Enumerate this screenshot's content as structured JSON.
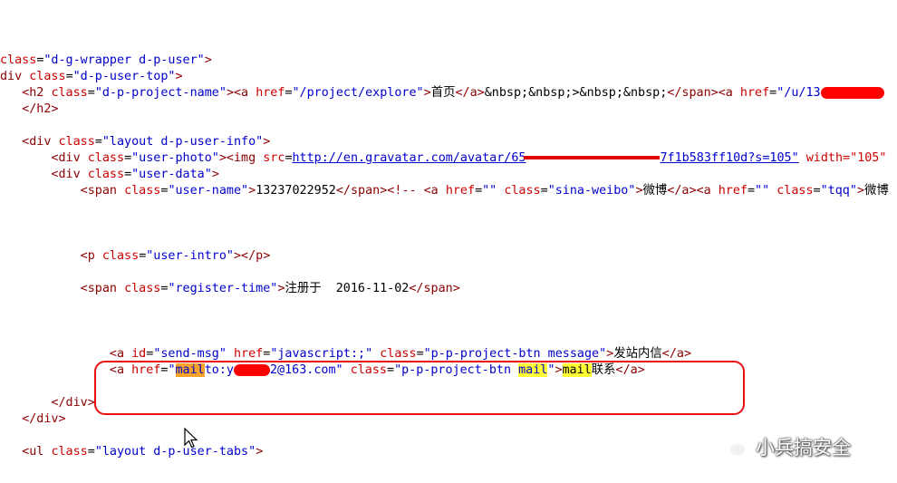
{
  "lines": [
    {
      "seg": [
        {
          "c": "attr",
          "t": "class"
        },
        {
          "c": "txt",
          "t": "="
        },
        {
          "c": "val",
          "t": "\"d-g-wrapper d-p-user\""
        },
        {
          "c": "tag",
          "t": ">"
        }
      ]
    },
    {
      "seg": [
        {
          "c": "tag",
          "t": "div "
        },
        {
          "c": "attr",
          "t": "class"
        },
        {
          "c": "txt",
          "t": "="
        },
        {
          "c": "val",
          "t": "\"d-p-user-top\""
        },
        {
          "c": "tag",
          "t": ">"
        }
      ]
    },
    {
      "seg": [
        {
          "c": "tag",
          "t": "   <h2 "
        },
        {
          "c": "attr",
          "t": "class"
        },
        {
          "c": "txt",
          "t": "="
        },
        {
          "c": "val",
          "t": "\"d-p-project-name\""
        },
        {
          "c": "tag",
          "t": "><a "
        },
        {
          "c": "attr",
          "t": "href"
        },
        {
          "c": "txt",
          "t": "="
        },
        {
          "c": "val",
          "t": "\"/project/explore\""
        },
        {
          "c": "tag",
          "t": ">"
        },
        {
          "c": "txt",
          "t": "首页"
        },
        {
          "c": "tag",
          "t": "</a>"
        },
        {
          "c": "txt",
          "t": "&nbsp;&nbsp;>&nbsp;&nbsp;"
        },
        {
          "c": "tag",
          "t": "</span><a "
        },
        {
          "c": "attr",
          "t": "href"
        },
        {
          "c": "txt",
          "t": "="
        },
        {
          "c": "val",
          "t": "\"/u/13"
        }
      ]
    },
    {
      "seg": [
        {
          "c": "tag",
          "t": "   </h2>"
        }
      ]
    },
    {
      "seg": []
    },
    {
      "seg": [
        {
          "c": "tag",
          "t": "   <div "
        },
        {
          "c": "attr",
          "t": "class"
        },
        {
          "c": "txt",
          "t": "="
        },
        {
          "c": "val",
          "t": "\"layout d-p-user-info\""
        },
        {
          "c": "tag",
          "t": ">"
        }
      ]
    },
    {
      "seg": [
        {
          "c": "tag",
          "t": "       <div "
        },
        {
          "c": "attr",
          "t": "class"
        },
        {
          "c": "txt",
          "t": "="
        },
        {
          "c": "val",
          "t": "\"user-photo\""
        },
        {
          "c": "tag",
          "t": "><img "
        },
        {
          "c": "attr",
          "t": "src"
        },
        {
          "c": "txt",
          "t": "="
        },
        {
          "c": "link",
          "t": "http://en.gravatar.com/avatar/65"
        }
      ]
    },
    {
      "seg": [
        {
          "c": "tag",
          "t": "       <div "
        },
        {
          "c": "attr",
          "t": "class"
        },
        {
          "c": "txt",
          "t": "="
        },
        {
          "c": "val",
          "t": "\"user-data\""
        },
        {
          "c": "tag",
          "t": ">"
        }
      ]
    },
    {
      "seg": [
        {
          "c": "tag",
          "t": "           <span "
        },
        {
          "c": "attr",
          "t": "class"
        },
        {
          "c": "txt",
          "t": "="
        },
        {
          "c": "val",
          "t": "\"user-name\""
        },
        {
          "c": "tag",
          "t": ">"
        },
        {
          "c": "txt",
          "t": "13237022952"
        },
        {
          "c": "tag",
          "t": "</span><!-- <a "
        },
        {
          "c": "attr",
          "t": "href"
        },
        {
          "c": "txt",
          "t": "="
        },
        {
          "c": "val",
          "t": "\"\""
        },
        {
          "c": "txt",
          "t": " "
        },
        {
          "c": "attr",
          "t": "class"
        },
        {
          "c": "txt",
          "t": "="
        },
        {
          "c": "val",
          "t": "\"sina-weibo\""
        },
        {
          "c": "tag",
          "t": ">"
        },
        {
          "c": "txt",
          "t": "微博"
        },
        {
          "c": "tag",
          "t": "</a><a "
        },
        {
          "c": "attr",
          "t": "href"
        },
        {
          "c": "txt",
          "t": "="
        },
        {
          "c": "val",
          "t": "\"\""
        },
        {
          "c": "txt",
          "t": " "
        },
        {
          "c": "attr",
          "t": "class"
        },
        {
          "c": "txt",
          "t": "="
        },
        {
          "c": "val",
          "t": "\"tqq\""
        },
        {
          "c": "tag",
          "t": ">"
        },
        {
          "c": "txt",
          "t": "微博"
        }
      ]
    },
    {
      "seg": []
    },
    {
      "seg": []
    },
    {
      "seg": []
    },
    {
      "seg": [
        {
          "c": "tag",
          "t": "           <p "
        },
        {
          "c": "attr",
          "t": "class"
        },
        {
          "c": "txt",
          "t": "="
        },
        {
          "c": "val",
          "t": "\"user-intro\""
        },
        {
          "c": "tag",
          "t": "></p>"
        }
      ]
    },
    {
      "seg": []
    },
    {
      "seg": [
        {
          "c": "tag",
          "t": "           <span "
        },
        {
          "c": "attr",
          "t": "class"
        },
        {
          "c": "txt",
          "t": "="
        },
        {
          "c": "val",
          "t": "\"register-time\""
        },
        {
          "c": "tag",
          "t": ">"
        },
        {
          "c": "txt",
          "t": "注册于  2016-11-02"
        },
        {
          "c": "tag",
          "t": "</span>"
        }
      ]
    },
    {
      "seg": []
    },
    {
      "seg": []
    },
    {
      "seg": []
    },
    {
      "seg": [
        {
          "c": "tag",
          "t": "               <a "
        },
        {
          "c": "attr",
          "t": "id"
        },
        {
          "c": "txt",
          "t": "="
        },
        {
          "c": "val",
          "t": "\"send-msg\""
        },
        {
          "c": "txt",
          "t": " "
        },
        {
          "c": "attr",
          "t": "href"
        },
        {
          "c": "txt",
          "t": "="
        },
        {
          "c": "val",
          "t": "\"javascript:;\""
        },
        {
          "c": "txt",
          "t": " "
        },
        {
          "c": "attr",
          "t": "class"
        },
        {
          "c": "txt",
          "t": "="
        },
        {
          "c": "val",
          "t": "\"p-p-project-btn message\""
        },
        {
          "c": "tag",
          "t": ">"
        },
        {
          "c": "txt",
          "t": "发站内信"
        },
        {
          "c": "tag",
          "t": "</a>"
        }
      ]
    },
    {
      "seg": [
        {
          "c": "tag",
          "t": "               <a "
        },
        {
          "c": "attr",
          "t": "href"
        },
        {
          "c": "txt",
          "t": "="
        },
        {
          "c": "val",
          "t": "\""
        },
        {
          "c": "val hl-orange",
          "t": "mail"
        },
        {
          "c": "val",
          "t": "to:y"
        },
        {
          "c": "redact",
          "t": ""
        },
        {
          "c": "val",
          "t": "2@163.com\""
        },
        {
          "c": "txt",
          "t": " "
        },
        {
          "c": "attr",
          "t": "class"
        },
        {
          "c": "txt",
          "t": "="
        },
        {
          "c": "val",
          "t": "\"p-p-project-btn "
        },
        {
          "c": "val hl-yellow",
          "t": "mail"
        },
        {
          "c": "val",
          "t": "\""
        },
        {
          "c": "tag",
          "t": ">"
        },
        {
          "c": "txt hl-yellow",
          "t": "mail"
        },
        {
          "c": "txt",
          "t": "联系"
        },
        {
          "c": "tag",
          "t": "</a>"
        }
      ]
    },
    {
      "seg": []
    },
    {
      "seg": [
        {
          "c": "tag",
          "t": "       </div>"
        }
      ]
    },
    {
      "seg": [
        {
          "c": "tag",
          "t": "   </div>"
        }
      ]
    },
    {
      "seg": []
    },
    {
      "seg": [
        {
          "c": "tag",
          "t": "   <ul "
        },
        {
          "c": "attr",
          "t": "class"
        },
        {
          "c": "txt",
          "t": "="
        },
        {
          "c": "val",
          "t": "\"layout d-p-user-tabs\""
        },
        {
          "c": "tag",
          "t": ">"
        }
      ]
    }
  ],
  "line6_tail": "7f1b583ff10d?s=105\"",
  "line6_width": "width=\"105\"",
  "watermark": {
    "text": "小兵搞安全",
    "icon": "wechat-icon"
  },
  "colors": {
    "highlight_box": "#e81010",
    "search_current": "#f7a329",
    "search_match": "#ffff33",
    "redaction": "#ff0000"
  }
}
